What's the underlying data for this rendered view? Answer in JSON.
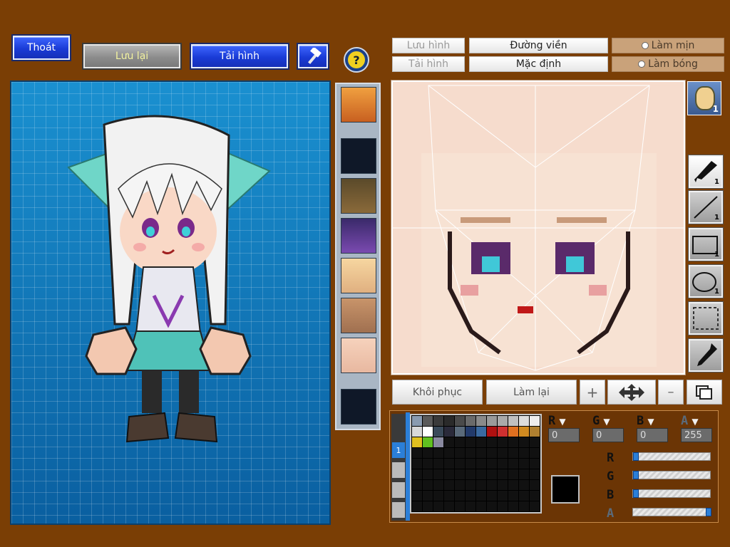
{
  "top_left": {
    "exit_label": "Thoát",
    "save_label": "Lưu lại",
    "load_label": "Tải hình"
  },
  "top_right": {
    "save_image_label": "Lưu hình",
    "load_image_label": "Tải hình",
    "outline_label": "Đường viền",
    "default_label": "Mặc định",
    "smooth_label": "Làm mịn",
    "shade_label": "Làm bóng"
  },
  "bottom_buttons": {
    "restore_label": "Khôi phục",
    "redo_label": "Làm lại"
  },
  "tools": [
    {
      "name": "brush-tool",
      "count": "1"
    },
    {
      "name": "line-tool",
      "count": "1"
    },
    {
      "name": "rectangle-tool",
      "count": "1"
    },
    {
      "name": "ellipse-tool",
      "count": "1"
    },
    {
      "name": "select-tool",
      "count": ""
    },
    {
      "name": "eyedropper-tool",
      "count": ""
    }
  ],
  "face_badge_count": "1",
  "palette": {
    "channels": [
      {
        "label": "R",
        "value": "0",
        "slider": 0.0
      },
      {
        "label": "G",
        "value": "0",
        "slider": 0.0
      },
      {
        "label": "B",
        "value": "0",
        "slider": 0.0
      },
      {
        "label": "A",
        "value": "255",
        "slider": 1.0
      }
    ],
    "current_color": "#000000",
    "swatches": [
      "#8a9bb0",
      "#5a5a5a",
      "#3a3a3a",
      "#2a2a2a",
      "#4a4a4a",
      "#6a6a6a",
      "#8a8a8a",
      "#9a9a9a",
      "#aaaaaa",
      "#c0c0c0",
      "#dddddd",
      "#eeeeee",
      "#d8d8d8",
      "#ffffff",
      "#3a4a5a",
      "#2a2a3a",
      "#5a6a7a",
      "#223a6a",
      "#3a6aa0",
      "#b01010",
      "#d03030",
      "#e07020",
      "#d08a20",
      "#b08030",
      "#e0c020",
      "#60c020",
      "#8a8aa0"
    ]
  },
  "colors": {
    "background": "#7a3e05",
    "accent_blue": "#1a3bd6"
  }
}
